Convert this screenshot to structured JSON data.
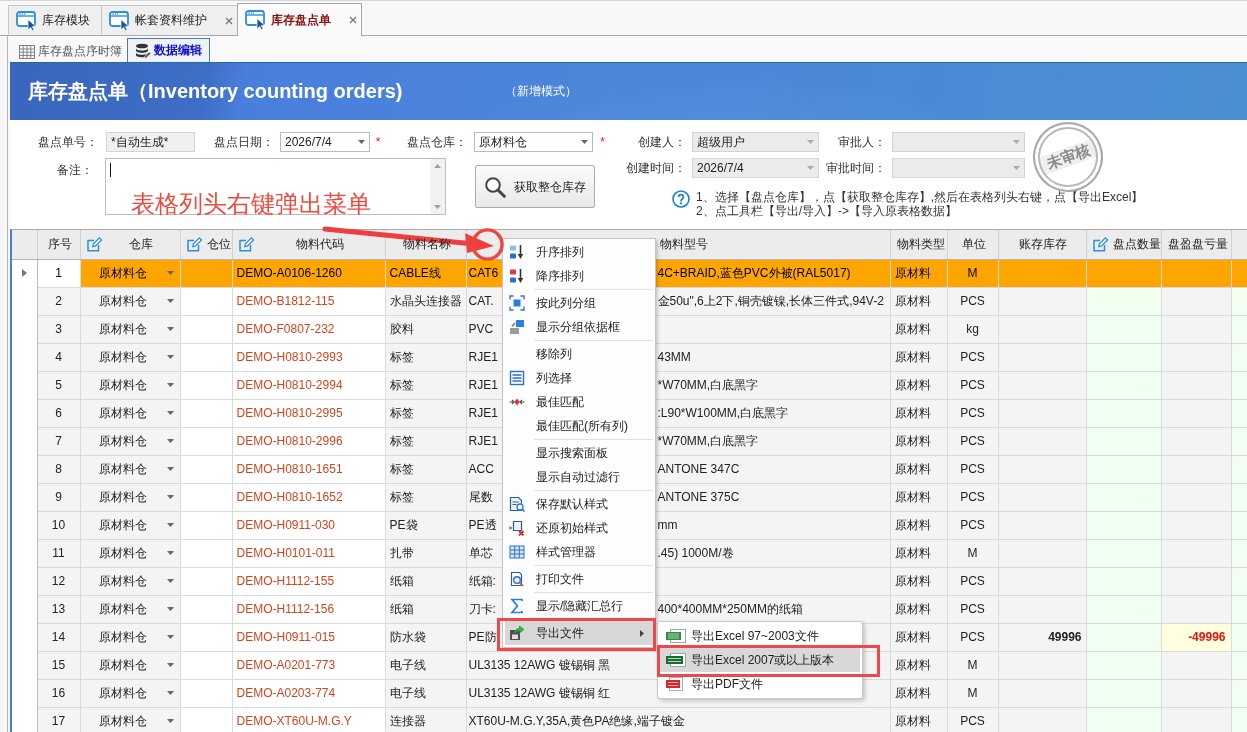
{
  "tabs": [
    {
      "label": "库存模块",
      "selected": false,
      "closable": false
    },
    {
      "label": "帐套资料维护",
      "selected": false,
      "closable": true
    },
    {
      "label": "库存盘点单",
      "selected": true,
      "closable": true
    }
  ],
  "sub_tabs": [
    {
      "label": "库存盘点序时簿",
      "selected": false
    },
    {
      "label": "数据编辑",
      "selected": true
    }
  ],
  "header": {
    "title": "库存盘点单（Inventory counting orders)",
    "mode": "（新增模式）"
  },
  "form": {
    "order_no": {
      "kind": "text",
      "label": "盘点单号：",
      "value": "*自动生成*",
      "disabled": true
    },
    "count_date": {
      "kind": "combo",
      "label": "盘点日期：",
      "value": "2026/7/4",
      "required_mark": "*",
      "disabled": false
    },
    "warehouse": {
      "kind": "combo",
      "label": "盘点仓库：",
      "value": "原材料仓",
      "required_mark": "*",
      "disabled": false
    },
    "creator": {
      "kind": "combo",
      "label": "创建人：",
      "value": "超级用户",
      "disabled": true
    },
    "approver": {
      "kind": "combo",
      "label": "审批人：",
      "disabled": true
    },
    "created_at": {
      "kind": "combo",
      "label": "创建时间：",
      "value": "2026/7/4",
      "disabled": true
    },
    "approved_at": {
      "kind": "combo",
      "label": "审批时间：",
      "disabled": true
    },
    "remark": {
      "label": "备注：",
      "focused": true
    },
    "fetch_button": {
      "label": "获取整仓库存"
    },
    "help_lines": [
      "1、选择【盘点仓库】，点【获取整仓库存】,然后在表格列头右键，点【导出Excel】",
      "2、点工具栏【导出/导入】->【导入原表格数据】"
    ],
    "stamp": "未审核"
  },
  "table": {
    "columns": [
      {
        "label": "序号",
        "editable": false
      },
      {
        "label": "仓库",
        "editable": true
      },
      {
        "label": "仓位",
        "editable": true
      },
      {
        "label": "物料代码",
        "editable": true
      },
      {
        "label": "物料名称",
        "editable": false
      },
      {
        "label": "物料型号",
        "editable": false
      },
      {
        "label": "物料类型",
        "editable": false
      },
      {
        "label": "单位",
        "editable": false
      },
      {
        "label": "账存库存",
        "editable": false
      },
      {
        "label": "盘点数量",
        "editable": true
      },
      {
        "label": "盘盈盘亏量",
        "editable": false
      }
    ],
    "rows": [
      {
        "no": "1",
        "warehouse": "原材料仓",
        "code": "DEMO-A0106-1260",
        "name": "CABLE线",
        "model": "CAT6",
        "model_tail": "4C+BRAID,蓝色PVC外被(RAL5017)",
        "type": "原材料",
        "unit": "M",
        "selected": true
      },
      {
        "no": "2",
        "warehouse": "原材料仓",
        "code": "DEMO-B1812-115",
        "name": "水晶头连接器",
        "model": "CAT.",
        "model_tail": "金50u\",6上2下,铜壳镀镍,长体三件式,94V-2",
        "type": "原材料",
        "unit": "PCS",
        "selected": false
      },
      {
        "no": "3",
        "warehouse": "原材料仓",
        "code": "DEMO-F0807-232",
        "name": "胶料",
        "model": "PVC",
        "type": "原材料",
        "unit": "kg",
        "selected": false
      },
      {
        "no": "4",
        "warehouse": "原材料仓",
        "code": "DEMO-H0810-2993",
        "name": "标签",
        "model": "RJE1",
        "model_tail": "43MM",
        "type": "原材料",
        "unit": "PCS",
        "selected": false
      },
      {
        "no": "5",
        "warehouse": "原材料仓",
        "code": "DEMO-H0810-2994",
        "name": "标签",
        "model": "RJE1",
        "model_tail": "*W70MM,白底黑字",
        "type": "原材料",
        "unit": "PCS",
        "selected": false
      },
      {
        "no": "6",
        "warehouse": "原材料仓",
        "code": "DEMO-H0810-2995",
        "name": "标签",
        "model": "RJE1",
        "model_tail": ":L90*W100MM,白底黑字",
        "type": "原材料",
        "unit": "PCS",
        "selected": false
      },
      {
        "no": "7",
        "warehouse": "原材料仓",
        "code": "DEMO-H0810-2996",
        "name": "标签",
        "model": "RJE1",
        "model_tail": "*W70MM,白底黑字",
        "type": "原材料",
        "unit": "PCS",
        "selected": false
      },
      {
        "no": "8",
        "warehouse": "原材料仓",
        "code": "DEMO-H0810-1651",
        "name": "标签",
        "model": "ACC",
        "model_tail": "ANTONE 347C",
        "type": "原材料",
        "unit": "PCS",
        "selected": false
      },
      {
        "no": "9",
        "warehouse": "原材料仓",
        "code": "DEMO-H0810-1652",
        "name": "标签",
        "model": "尾数",
        "model_tail": "ANTONE 375C",
        "type": "原材料",
        "unit": "PCS",
        "selected": false
      },
      {
        "no": "10",
        "warehouse": "原材料仓",
        "code": "DEMO-H0911-030",
        "name": "PE袋",
        "model": "PE透",
        "model_tail": "mm",
        "type": "原材料",
        "unit": "PCS",
        "selected": false
      },
      {
        "no": "11",
        "warehouse": "原材料仓",
        "code": "DEMO-H0101-011",
        "name": "扎带",
        "model": "单芯",
        "model_tail": ".45) 1000M/卷",
        "type": "原材料",
        "unit": "M",
        "selected": false
      },
      {
        "no": "12",
        "warehouse": "原材料仓",
        "code": "DEMO-H1112-155",
        "name": "纸箱",
        "model": "纸箱:",
        "type": "原材料",
        "unit": "PCS",
        "selected": false
      },
      {
        "no": "13",
        "warehouse": "原材料仓",
        "code": "DEMO-H1112-156",
        "name": "纸箱",
        "model": "刀卡:",
        "model_tail": "400*400MM*250MM的纸箱",
        "type": "原材料",
        "unit": "PCS",
        "selected": false
      },
      {
        "no": "14",
        "warehouse": "原材料仓",
        "code": "DEMO-H0911-015",
        "name": "防水袋",
        "model": "PE防",
        "type": "原材料",
        "unit": "PCS",
        "book_stock": "49996",
        "variance": "-49996",
        "selected": false
      },
      {
        "no": "15",
        "warehouse": "原材料仓",
        "code": "DEMO-A0201-773",
        "name": "电子线",
        "model": "UL3135 12AWG 镀锡铜 黑",
        "type": "原材料",
        "unit": "M",
        "selected": false
      },
      {
        "no": "16",
        "warehouse": "原材料仓",
        "code": "DEMO-A0203-774",
        "name": "电子线",
        "model": "UL3135 12AWG 镀锡铜 红",
        "type": "原材料",
        "unit": "M",
        "selected": false
      },
      {
        "no": "17",
        "warehouse": "原材料仓",
        "code": "DEMO-XT60U-M.G.Y",
        "name": "连接器",
        "model": "XT60U-M.G.Y,35A,黄色PA绝缘,端子镀金",
        "type": "原材料",
        "unit": "PCS",
        "selected": false
      }
    ]
  },
  "context_menu": {
    "groups": [
      [
        {
          "label": "升序排列",
          "highlighted": false,
          "annotated": false,
          "has_submenu": false
        },
        {
          "label": "降序排列",
          "highlighted": false,
          "annotated": false,
          "has_submenu": false
        }
      ],
      [
        {
          "label": "按此列分组",
          "highlighted": false,
          "annotated": false,
          "has_submenu": false
        },
        {
          "label": "显示分组依据框",
          "highlighted": false,
          "annotated": false,
          "has_submenu": false
        }
      ],
      [
        {
          "label": "移除列",
          "highlighted": false,
          "annotated": false,
          "has_submenu": false
        },
        {
          "label": "列选择",
          "highlighted": false,
          "annotated": false,
          "has_submenu": false
        },
        {
          "label": "最佳匹配",
          "highlighted": false,
          "annotated": false,
          "has_submenu": false
        },
        {
          "label": "最佳匹配(所有列)",
          "highlighted": false,
          "annotated": false,
          "has_submenu": false
        }
      ],
      [
        {
          "label": "显示搜索面板",
          "highlighted": false,
          "annotated": false,
          "has_submenu": false
        },
        {
          "label": "显示自动过滤行",
          "highlighted": false,
          "annotated": false,
          "has_submenu": false
        }
      ],
      [
        {
          "label": "保存默认样式",
          "highlighted": false,
          "annotated": false,
          "has_submenu": false
        },
        {
          "label": "还原初始样式",
          "highlighted": false,
          "annotated": false,
          "has_submenu": false
        },
        {
          "label": "样式管理器",
          "highlighted": false,
          "annotated": false,
          "has_submenu": false
        }
      ],
      [
        {
          "label": "打印文件",
          "highlighted": false,
          "annotated": false,
          "has_submenu": false
        }
      ],
      [
        {
          "label": "显示/隐藏汇总行",
          "highlighted": false,
          "annotated": false,
          "has_submenu": false
        }
      ],
      [
        {
          "label": "导出文件",
          "highlighted": true,
          "annotated": true,
          "has_submenu": true
        }
      ]
    ]
  },
  "export_submenu": {
    "items": [
      {
        "label": "导出Excel 97~2003文件",
        "highlighted": false,
        "annotated": false
      },
      {
        "label": "导出Excel 2007或以上版本",
        "highlighted": true,
        "annotated": true
      },
      {
        "label": "导出PDF文件",
        "highlighted": false,
        "annotated": false
      }
    ]
  },
  "callout": {
    "text": "表格列头右键弹出菜单"
  }
}
